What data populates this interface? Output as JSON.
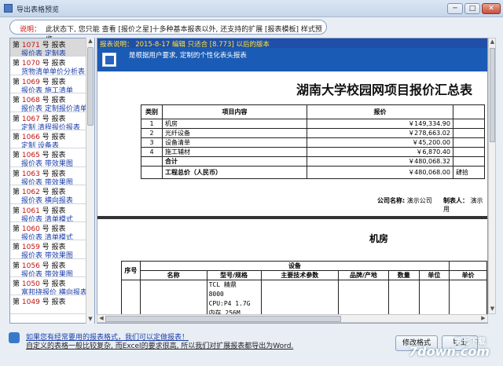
{
  "window": {
    "title": "导出表格预览"
  },
  "notice": {
    "label": "说明：",
    "text": "此状态下, 您只能 查看 [报价之星]十多种基本报表以外, 还支持的扩展 [报表模板] 样式预览"
  },
  "sidebar": {
    "items": [
      {
        "l1_pre": "第",
        "num": "1071",
        "l1_post": "号 报表",
        "l2": "报价表 定制表",
        "selected": true
      },
      {
        "l1_pre": "第",
        "num": "1070",
        "l1_post": "号 报表",
        "l2": "货物清单单价分析表"
      },
      {
        "l1_pre": "第",
        "num": "1069",
        "l1_post": "号 报表",
        "l2": "报价表 施工清单"
      },
      {
        "l1_pre": "第",
        "num": "1068",
        "l1_post": "号 报表",
        "l2": "报价表 定制报价清单表"
      },
      {
        "l1_pre": "第",
        "num": "1067",
        "l1_post": "号 报表",
        "l2": "定制 清程报价报表"
      },
      {
        "l1_pre": "第",
        "num": "1066",
        "l1_post": "号 报表",
        "l2": "定制 设备表"
      },
      {
        "l1_pre": "第",
        "num": "1065",
        "l1_post": "号 报表",
        "l2": "报价表 带效果图"
      },
      {
        "l1_pre": "第",
        "num": "1063",
        "l1_post": "号 报表",
        "l2": "报价表 带效果图"
      },
      {
        "l1_pre": "第",
        "num": "1062",
        "l1_post": "号 报表",
        "l2": "报价表 横向报表"
      },
      {
        "l1_pre": "第",
        "num": "1061",
        "l1_post": "号 报表",
        "l2": "报价表 清单模式"
      },
      {
        "l1_pre": "第",
        "num": "1060",
        "l1_post": "号 报表",
        "l2": "报价表 清单模式"
      },
      {
        "l1_pre": "第",
        "num": "1059",
        "l1_post": "号 报表",
        "l2": "报价表 带效果图"
      },
      {
        "l1_pre": "第",
        "num": "1056",
        "l1_post": "号 报表",
        "l2": "报价表 带效果图"
      },
      {
        "l1_pre": "第",
        "num": "1050",
        "l1_post": "号 报表",
        "l2": "富邦挠报价 横向报表"
      },
      {
        "l1_pre": "第",
        "num": "1049",
        "l1_post": "号 报表",
        "l2": ""
      }
    ]
  },
  "preview": {
    "header": "报表说明：   2015-8-17  编辑    只适合 [8.773] 以后的版本",
    "desc": "是根据用户要求, 定制的个性化表头报表",
    "title": "湖南大学校园网项目报价汇总表",
    "summary": {
      "headers": [
        "类别",
        "项目内容",
        "报价",
        ""
      ],
      "rows": [
        {
          "idx": "1",
          "name": "机房",
          "price": "￥149,334.90"
        },
        {
          "idx": "2",
          "name": "光纤设备",
          "price": "￥278,663.02"
        },
        {
          "idx": "3",
          "name": "设备清单",
          "price": "￥45,200.00"
        },
        {
          "idx": "4",
          "name": "施工辅材",
          "price": "￥6,870.40"
        }
      ],
      "subtotal_label": "合计",
      "subtotal_value": "￥480,068.32",
      "total_label": "工程总价（人民币）",
      "total_value": "￥480,068.00",
      "total_extra": "肆拾"
    },
    "company_label": "公司名称:",
    "company_value": "演示公司",
    "maker_label": "制表人：",
    "maker_value": "演示用",
    "section2_title": "机房",
    "device": {
      "group": "设备",
      "cols": [
        "序号",
        "名称",
        "型号/规格",
        "主要技术参数",
        "品牌/产地",
        "数量",
        "单位",
        "单价"
      ],
      "cell_lines": [
        "TCL 精鼎",
        "8000",
        "CPU:P4 1.7G",
        "内存 256M"
      ]
    }
  },
  "footer": {
    "link": "如果您有经常要用的报表格式，我们可以定做报表！",
    "text": "自定义的表格一般比较复杂, 而Excel的要求很高, 所以我们对扩展报表都导出为Word.",
    "btn_format": "修改格式",
    "btn_export": "导出"
  },
  "watermark": {
    "main": "7down.com",
    "sub": "第七下载"
  }
}
